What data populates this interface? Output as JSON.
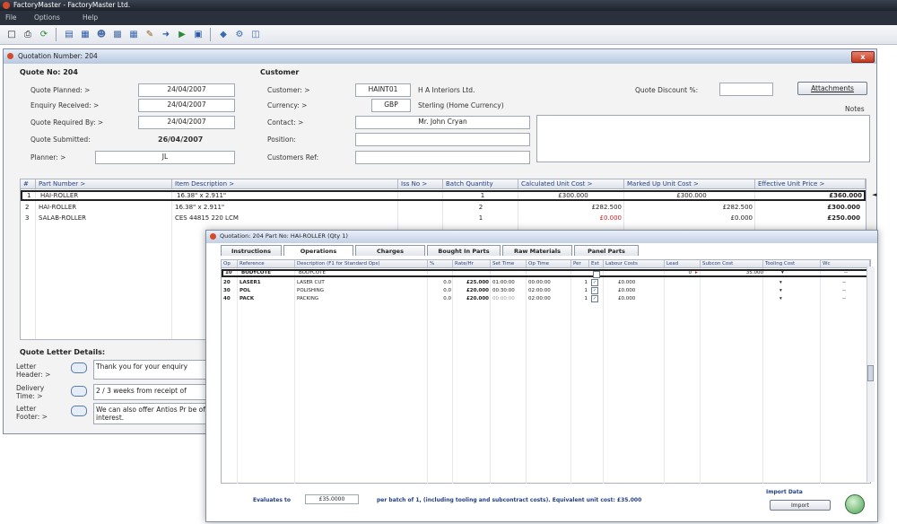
{
  "app": {
    "title": "FactoryMaster - FactoryMaster Ltd.",
    "menu": [
      "File",
      "Options",
      "Help"
    ],
    "toolbar_icons": [
      "new-icon",
      "print-icon",
      "refresh-icon",
      "list-icon",
      "grid-icon",
      "users-icon",
      "report-icon",
      "calendar-icon",
      "edit-icon",
      "go-icon",
      "play-icon",
      "save-icon",
      "link-icon",
      "tools-icon",
      "book-icon"
    ]
  },
  "quote": {
    "window_title": "Quotation Number: 204",
    "close_label": "x",
    "section_quote": "Quote No: 204",
    "section_customer": "Customer",
    "labels": {
      "planned": "Quote Planned: >",
      "received": "Enquiry Received: >",
      "required": "Quote Required By: >",
      "submitted": "Quote Submitted:",
      "planner": "Planner: >",
      "customer": "Customer: >",
      "currency": "Currency: >",
      "contact": "Contact: >",
      "position": "Position:",
      "customer_ref": "Customers Ref:",
      "discount": "Quote Discount %:",
      "notes": "Notes"
    },
    "values": {
      "planned": "24/04/2007",
      "received": "24/04/2007",
      "required": "24/04/2007",
      "submitted": "26/04/2007",
      "planner": "JL",
      "customer_code": "HAINT01",
      "customer_name": "H A Interiors Ltd.",
      "currency_code": "GBP",
      "currency_name": "Sterling  (Home Currency)",
      "contact": "Mr. John Cryan",
      "position": "",
      "customer_ref": "",
      "discount": ""
    },
    "attachments_label": "Attachments",
    "table": {
      "columns": [
        "#",
        "Part Number >",
        "Item Description >",
        "Iss No >",
        "Batch Quantity",
        "Calculated Unit Cost >",
        "Marked Up Unit Cost >",
        "Effective Unit Price >"
      ],
      "rows": [
        {
          "n": "1",
          "part": "HAI-ROLLER",
          "desc": "16.38\" x 2.911\"",
          "iss": "",
          "qty": "1",
          "calc": "£300.000",
          "marked": "£300.000",
          "eff": "£360.000"
        },
        {
          "n": "2",
          "part": "HAI-ROLLER",
          "desc": "16.38\" x 2.911\"",
          "iss": "",
          "qty": "2",
          "calc": "£282.500",
          "marked": "£282.500",
          "eff": "£300.000"
        },
        {
          "n": "3",
          "part": "SALAB-ROLLER",
          "desc": "CES 44815 220 LCM",
          "iss": "",
          "qty": "1",
          "calc": "£0.000",
          "marked": "£0.000",
          "eff": "£250.000"
        }
      ]
    },
    "letter": {
      "title": "Quote Letter Details:",
      "header_label": "Letter Header: >",
      "header_text": "Thank you for your enquiry",
      "delivery_label": "Delivery Time: >",
      "delivery_text": "2 / 3 weeks from receipt of",
      "footer_label": "Letter Footer: >",
      "footer_text": "We can also offer Antios Pr be of interest."
    }
  },
  "ops": {
    "window_title": "Quotation: 204   Part No: HAI-ROLLER   (Qty 1)",
    "tabs": [
      "Instructions",
      "Operations",
      "Charges",
      "Bought In Parts",
      "Raw Materials",
      "Panel Parts"
    ],
    "active_tab": "Operations",
    "columns": [
      "Op",
      "Reference",
      "Description (F1 for Standard Ops)",
      "%",
      "Rate/Hr",
      "Set Time",
      "Op Time",
      "Per",
      "Ext",
      "Labour Costs",
      "Lead",
      "Subcon Cost",
      "Tooling Cost",
      "Wc"
    ],
    "rows": [
      {
        "op": "10",
        "ref": "BODYCOTE",
        "desc": "BODYCOTE",
        "pct": "",
        "rate": "",
        "set": "",
        "optime": "",
        "per": "",
        "ext": "",
        "labour": "",
        "lead": "0",
        "subcon": "35.000",
        "tool": "",
        "wc": "--"
      },
      {
        "op": "20",
        "ref": "LASER1",
        "desc": "LASER CUT",
        "pct": "0.0",
        "rate": "£25.000",
        "set": "01:00:00",
        "optime": "00:00:00",
        "per": "1",
        "ext": "",
        "labour": "£0.000",
        "lead": "",
        "subcon": "",
        "tool": "",
        "wc": "--"
      },
      {
        "op": "30",
        "ref": "POL",
        "desc": "POLISHING",
        "pct": "0.0",
        "rate": "£20.000",
        "set": "00:30:00",
        "optime": "02:00:00",
        "per": "1",
        "ext": "",
        "labour": "£0.000",
        "lead": "",
        "subcon": "",
        "tool": "",
        "wc": "--"
      },
      {
        "op": "40",
        "ref": "PACK",
        "desc": "PACKING",
        "pct": "0.0",
        "rate": "£20.000",
        "set": "00:00:00",
        "optime": "02:00:00",
        "per": "1",
        "ext": "",
        "labour": "£0.000",
        "lead": "",
        "subcon": "",
        "tool": "",
        "wc": "--"
      }
    ],
    "footer": {
      "evaluates_label": "Evaluates to",
      "evaluates_value": "£35.0000",
      "summary": "per batch of 1, (including tooling and subcontract costs). Equivalent unit cost: £35.000",
      "import_title": "Import Data",
      "import_button": "Import"
    }
  },
  "colors": {
    "accent": "#1f3f86",
    "warning": "#d02020",
    "close": "#c2391f"
  }
}
